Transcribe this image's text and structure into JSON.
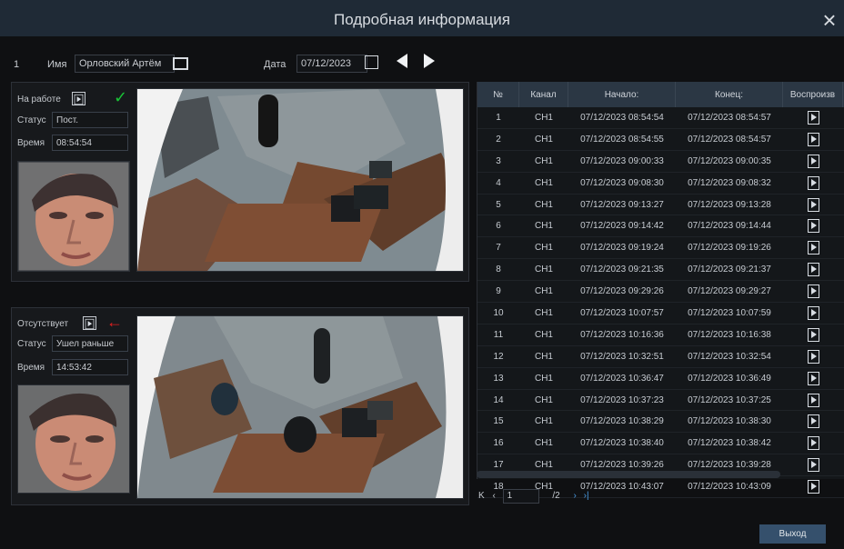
{
  "window": {
    "title": "Подробная информация"
  },
  "topbar": {
    "id": "1",
    "name_label": "Имя",
    "name_value": "Орловский Артём",
    "date_label": "Дата",
    "date_value": "07/12/2023"
  },
  "upper": {
    "state": "На работе",
    "status_label": "Статус",
    "status_value": "Пост.",
    "time_label": "Время",
    "time_value": "08:54:54"
  },
  "lower": {
    "state": "Отсутствует",
    "status_label": "Статус",
    "status_value": "Ушел раньше",
    "time_label": "Время",
    "time_value": "14:53:42"
  },
  "table": {
    "headers": [
      "№",
      "Канал",
      "Начало:",
      "Конец:",
      "Воспроизв"
    ],
    "rows": [
      [
        "1",
        "CH1",
        "07/12/2023 08:54:54",
        "07/12/2023 08:54:57"
      ],
      [
        "2",
        "CH1",
        "07/12/2023 08:54:55",
        "07/12/2023 08:54:57"
      ],
      [
        "3",
        "CH1",
        "07/12/2023 09:00:33",
        "07/12/2023 09:00:35"
      ],
      [
        "4",
        "CH1",
        "07/12/2023 09:08:30",
        "07/12/2023 09:08:32"
      ],
      [
        "5",
        "CH1",
        "07/12/2023 09:13:27",
        "07/12/2023 09:13:28"
      ],
      [
        "6",
        "CH1",
        "07/12/2023 09:14:42",
        "07/12/2023 09:14:44"
      ],
      [
        "7",
        "CH1",
        "07/12/2023 09:19:24",
        "07/12/2023 09:19:26"
      ],
      [
        "8",
        "CH1",
        "07/12/2023 09:21:35",
        "07/12/2023 09:21:37"
      ],
      [
        "9",
        "CH1",
        "07/12/2023 09:29:26",
        "07/12/2023 09:29:27"
      ],
      [
        "10",
        "CH1",
        "07/12/2023 10:07:57",
        "07/12/2023 10:07:59"
      ],
      [
        "11",
        "CH1",
        "07/12/2023 10:16:36",
        "07/12/2023 10:16:38"
      ],
      [
        "12",
        "CH1",
        "07/12/2023 10:32:51",
        "07/12/2023 10:32:54"
      ],
      [
        "13",
        "CH1",
        "07/12/2023 10:36:47",
        "07/12/2023 10:36:49"
      ],
      [
        "14",
        "CH1",
        "07/12/2023 10:37:23",
        "07/12/2023 10:37:25"
      ],
      [
        "15",
        "CH1",
        "07/12/2023 10:38:29",
        "07/12/2023 10:38:30"
      ],
      [
        "16",
        "CH1",
        "07/12/2023 10:38:40",
        "07/12/2023 10:38:42"
      ],
      [
        "17",
        "CH1",
        "07/12/2023 10:39:26",
        "07/12/2023 10:39:28"
      ],
      [
        "18",
        "CH1",
        "07/12/2023 10:43:07",
        "07/12/2023 10:43:09"
      ]
    ]
  },
  "pager": {
    "current": "1",
    "total": "/2"
  },
  "footer": {
    "exit": "Выход"
  }
}
